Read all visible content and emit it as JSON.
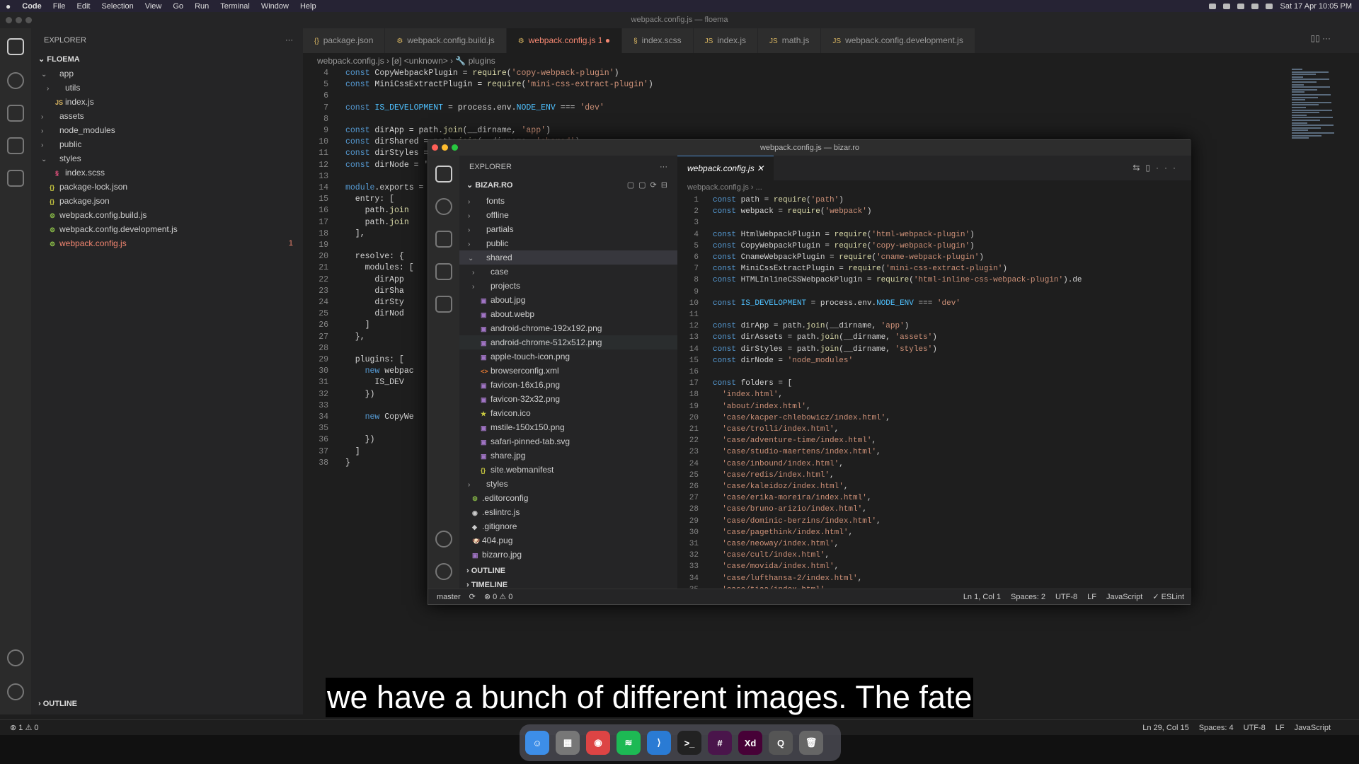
{
  "menubar": {
    "apple": "",
    "items": [
      "Code",
      "File",
      "Edit",
      "Selection",
      "View",
      "Go",
      "Run",
      "Terminal",
      "Window",
      "Help"
    ],
    "clock": "Sat 17 Apr  10:05 PM"
  },
  "back_window": {
    "title": "webpack.config.js — floema",
    "explorer_header": "EXPLORER",
    "project": "FLOEMA",
    "tree": [
      {
        "label": "app",
        "indent": 1,
        "chevron": "⌄",
        "icon": ""
      },
      {
        "label": "utils",
        "indent": 2,
        "chevron": "›",
        "icon": ""
      },
      {
        "label": "index.js",
        "indent": 2,
        "chevron": "",
        "icon": "JS"
      },
      {
        "label": "assets",
        "indent": 1,
        "chevron": "›",
        "icon": ""
      },
      {
        "label": "node_modules",
        "indent": 1,
        "chevron": "›",
        "icon": ""
      },
      {
        "label": "public",
        "indent": 1,
        "chevron": "›",
        "icon": ""
      },
      {
        "label": "styles",
        "indent": 1,
        "chevron": "⌄",
        "icon": ""
      },
      {
        "label": "index.scss",
        "indent": 2,
        "chevron": "",
        "icon": "§"
      },
      {
        "label": "package-lock.json",
        "indent": 1,
        "chevron": "",
        "icon": "{}"
      },
      {
        "label": "package.json",
        "indent": 1,
        "chevron": "",
        "icon": "{}"
      },
      {
        "label": "webpack.config.build.js",
        "indent": 1,
        "chevron": "",
        "icon": "⚙"
      },
      {
        "label": "webpack.config.development.js",
        "indent": 1,
        "chevron": "",
        "icon": "⚙"
      },
      {
        "label": "webpack.config.js",
        "indent": 1,
        "chevron": "",
        "icon": "⚙",
        "error": "1"
      }
    ],
    "outline_label": "OUTLINE",
    "tabs": [
      {
        "icon": "{}",
        "label": "package.json"
      },
      {
        "icon": "⚙",
        "label": "webpack.config.build.js"
      },
      {
        "icon": "⚙",
        "label": "webpack.config.js 1",
        "active": true
      },
      {
        "icon": "§",
        "label": "index.scss"
      },
      {
        "icon": "JS",
        "label": "index.js"
      },
      {
        "icon": "JS",
        "label": "math.js"
      },
      {
        "icon": "JS",
        "label": "webpack.config.development.js"
      }
    ],
    "breadcrumb": "webpack.config.js  ›  [ø] <unknown>  ›  🔧 plugins",
    "code_lines": [
      {
        "n": "4",
        "t": "const CopyWebpackPlugin = require('copy-webpack-plugin')"
      },
      {
        "n": "5",
        "t": "const MiniCssExtractPlugin = require('mini-css-extract-plugin')"
      },
      {
        "n": "6",
        "t": ""
      },
      {
        "n": "7",
        "t": "const IS_DEVELOPMENT = process.env.NODE_ENV === 'dev'"
      },
      {
        "n": "8",
        "t": ""
      },
      {
        "n": "9",
        "t": "const dirApp = path.join(__dirname, 'app')"
      },
      {
        "n": "10",
        "t": "const dirShared = path.join(__dirname, 'shared')"
      },
      {
        "n": "11",
        "t": "const dirStyles = p"
      },
      {
        "n": "12",
        "t": "const dirNode = 'n"
      },
      {
        "n": "13",
        "t": ""
      },
      {
        "n": "14",
        "t": "module.exports = {"
      },
      {
        "n": "15",
        "t": "  entry: ["
      },
      {
        "n": "16",
        "t": "    path.join"
      },
      {
        "n": "17",
        "t": "    path.join"
      },
      {
        "n": "18",
        "t": "  ],"
      },
      {
        "n": "19",
        "t": ""
      },
      {
        "n": "20",
        "t": "  resolve: {"
      },
      {
        "n": "21",
        "t": "    modules: ["
      },
      {
        "n": "22",
        "t": "      dirApp"
      },
      {
        "n": "23",
        "t": "      dirSha"
      },
      {
        "n": "24",
        "t": "      dirSty"
      },
      {
        "n": "25",
        "t": "      dirNod"
      },
      {
        "n": "26",
        "t": "    ]"
      },
      {
        "n": "27",
        "t": "  },"
      },
      {
        "n": "28",
        "t": ""
      },
      {
        "n": "29",
        "t": "  plugins: ["
      },
      {
        "n": "30",
        "t": "    new webpac"
      },
      {
        "n": "31",
        "t": "      IS_DEV"
      },
      {
        "n": "32",
        "t": "    })"
      },
      {
        "n": "33",
        "t": ""
      },
      {
        "n": "34",
        "t": "    new CopyWe"
      },
      {
        "n": "35",
        "t": ""
      },
      {
        "n": "36",
        "t": "    })"
      },
      {
        "n": "37",
        "t": "  ]"
      },
      {
        "n": "38",
        "t": "}"
      }
    ],
    "status_left": "⊗ 1 ⚠ 0",
    "status_right": [
      "Ln 29, Col 15",
      "Spaces: 4",
      "UTF-8",
      "LF",
      "JavaScript"
    ]
  },
  "front_window": {
    "title": "webpack.config.js — bizar.ro",
    "explorer_header": "EXPLORER",
    "project": "BIZAR.RO",
    "tree": [
      {
        "label": "fonts",
        "indent": 1,
        "chevron": "›",
        "icon": ""
      },
      {
        "label": "offline",
        "indent": 1,
        "chevron": "›",
        "icon": ""
      },
      {
        "label": "partials",
        "indent": 1,
        "chevron": "›",
        "icon": ""
      },
      {
        "label": "public",
        "indent": 1,
        "chevron": "›",
        "icon": ""
      },
      {
        "label": "shared",
        "indent": 1,
        "chevron": "⌄",
        "icon": "",
        "active": true
      },
      {
        "label": "case",
        "indent": 2,
        "chevron": "›",
        "icon": ""
      },
      {
        "label": "projects",
        "indent": 2,
        "chevron": "›",
        "icon": ""
      },
      {
        "label": "about.jpg",
        "indent": 2,
        "chevron": "",
        "icon": "▣"
      },
      {
        "label": "about.webp",
        "indent": 2,
        "chevron": "",
        "icon": "▣"
      },
      {
        "label": "android-chrome-192x192.png",
        "indent": 2,
        "chevron": "",
        "icon": "▣"
      },
      {
        "label": "android-chrome-512x512.png",
        "indent": 2,
        "chevron": "",
        "icon": "▣",
        "hover": true
      },
      {
        "label": "apple-touch-icon.png",
        "indent": 2,
        "chevron": "",
        "icon": "▣"
      },
      {
        "label": "browserconfig.xml",
        "indent": 2,
        "chevron": "",
        "icon": "<>"
      },
      {
        "label": "favicon-16x16.png",
        "indent": 2,
        "chevron": "",
        "icon": "▣"
      },
      {
        "label": "favicon-32x32.png",
        "indent": 2,
        "chevron": "",
        "icon": "▣"
      },
      {
        "label": "favicon.ico",
        "indent": 2,
        "chevron": "",
        "icon": "★"
      },
      {
        "label": "mstile-150x150.png",
        "indent": 2,
        "chevron": "",
        "icon": "▣"
      },
      {
        "label": "safari-pinned-tab.svg",
        "indent": 2,
        "chevron": "",
        "icon": "▣"
      },
      {
        "label": "share.jpg",
        "indent": 2,
        "chevron": "",
        "icon": "▣"
      },
      {
        "label": "site.webmanifest",
        "indent": 2,
        "chevron": "",
        "icon": "{}"
      },
      {
        "label": "styles",
        "indent": 1,
        "chevron": "›",
        "icon": ""
      },
      {
        "label": ".editorconfig",
        "indent": 0,
        "chevron": "",
        "icon": "⚙"
      },
      {
        "label": ".eslintrc.js",
        "indent": 0,
        "chevron": "",
        "icon": "◉"
      },
      {
        "label": ".gitignore",
        "indent": 0,
        "chevron": "",
        "icon": "◆"
      },
      {
        "label": "404.pug",
        "indent": 0,
        "chevron": "",
        "icon": "🐶"
      },
      {
        "label": "bizarro.jpg",
        "indent": 0,
        "chevron": "",
        "icon": "▣"
      }
    ],
    "outline_label": "OUTLINE",
    "timeline_label": "TIMELINE",
    "tab_label": "webpack.config.js",
    "breadcrumb": "webpack.config.js  ›  ...",
    "code_lines": [
      {
        "n": "1",
        "t": "const path = require('path')"
      },
      {
        "n": "2",
        "t": "const webpack = require('webpack')"
      },
      {
        "n": "3",
        "t": ""
      },
      {
        "n": "4",
        "t": "const HtmlWebpackPlugin = require('html-webpack-plugin')"
      },
      {
        "n": "5",
        "t": "const CopyWebpackPlugin = require('copy-webpack-plugin')"
      },
      {
        "n": "6",
        "t": "const CnameWebpackPlugin = require('cname-webpack-plugin')"
      },
      {
        "n": "7",
        "t": "const MiniCssExtractPlugin = require('mini-css-extract-plugin')"
      },
      {
        "n": "8",
        "t": "const HTMLInlineCSSWebpackPlugin = require('html-inline-css-webpack-plugin').de"
      },
      {
        "n": "9",
        "t": ""
      },
      {
        "n": "10",
        "t": "const IS_DEVELOPMENT = process.env.NODE_ENV === 'dev'"
      },
      {
        "n": "11",
        "t": ""
      },
      {
        "n": "12",
        "t": "const dirApp = path.join(__dirname, 'app')"
      },
      {
        "n": "13",
        "t": "const dirAssets = path.join(__dirname, 'assets')"
      },
      {
        "n": "14",
        "t": "const dirStyles = path.join(__dirname, 'styles')"
      },
      {
        "n": "15",
        "t": "const dirNode = 'node_modules'"
      },
      {
        "n": "16",
        "t": ""
      },
      {
        "n": "17",
        "t": "const folders = ["
      },
      {
        "n": "18",
        "t": "  'index.html',"
      },
      {
        "n": "19",
        "t": "  'about/index.html',"
      },
      {
        "n": "20",
        "t": "  'case/kacper-chlebowicz/index.html',"
      },
      {
        "n": "21",
        "t": "  'case/trolli/index.html',"
      },
      {
        "n": "22",
        "t": "  'case/adventure-time/index.html',"
      },
      {
        "n": "23",
        "t": "  'case/studio-maertens/index.html',"
      },
      {
        "n": "24",
        "t": "  'case/inbound/index.html',"
      },
      {
        "n": "25",
        "t": "  'case/redis/index.html',"
      },
      {
        "n": "26",
        "t": "  'case/kaleidoz/index.html',"
      },
      {
        "n": "27",
        "t": "  'case/erika-moreira/index.html',"
      },
      {
        "n": "28",
        "t": "  'case/bruno-arizio/index.html',"
      },
      {
        "n": "29",
        "t": "  'case/dominic-berzins/index.html',"
      },
      {
        "n": "30",
        "t": "  'case/pagethink/index.html',"
      },
      {
        "n": "31",
        "t": "  'case/neoway/index.html',"
      },
      {
        "n": "32",
        "t": "  'case/cult/index.html',"
      },
      {
        "n": "33",
        "t": "  'case/movida/index.html',"
      },
      {
        "n": "34",
        "t": "  'case/lufthansa-2/index.html',"
      },
      {
        "n": "35",
        "t": "  'case/tiaa/index.html',"
      }
    ],
    "status_left": [
      "master",
      "⟳",
      "⊗ 0 ⚠ 0"
    ],
    "status_right": [
      "Ln 1, Col 1",
      "Spaces: 2",
      "UTF-8",
      "LF",
      "JavaScript",
      "✓ ESLint"
    ]
  },
  "subtitle": "we have a bunch of different images. The fate",
  "dock": [
    {
      "name": "finder-icon",
      "glyph": "☺",
      "color": "#3d8ee8"
    },
    {
      "name": "launchpad-icon",
      "glyph": "▦",
      "color": "#777"
    },
    {
      "name": "chrome-icon",
      "glyph": "◉",
      "color": "#d44"
    },
    {
      "name": "spotify-icon",
      "glyph": "≋",
      "color": "#1db954"
    },
    {
      "name": "vscode-icon",
      "glyph": "⟩",
      "color": "#2a7bd4"
    },
    {
      "name": "terminal-icon",
      "glyph": ">_",
      "color": "#222"
    },
    {
      "name": "slack-icon",
      "glyph": "#",
      "color": "#4a154b"
    },
    {
      "name": "adobe-xd-icon",
      "glyph": "Xd",
      "color": "#470137"
    },
    {
      "name": "quicktime-icon",
      "glyph": "Q",
      "color": "#555"
    },
    {
      "name": "trash-icon",
      "glyph": "🗑",
      "color": "#666"
    }
  ]
}
